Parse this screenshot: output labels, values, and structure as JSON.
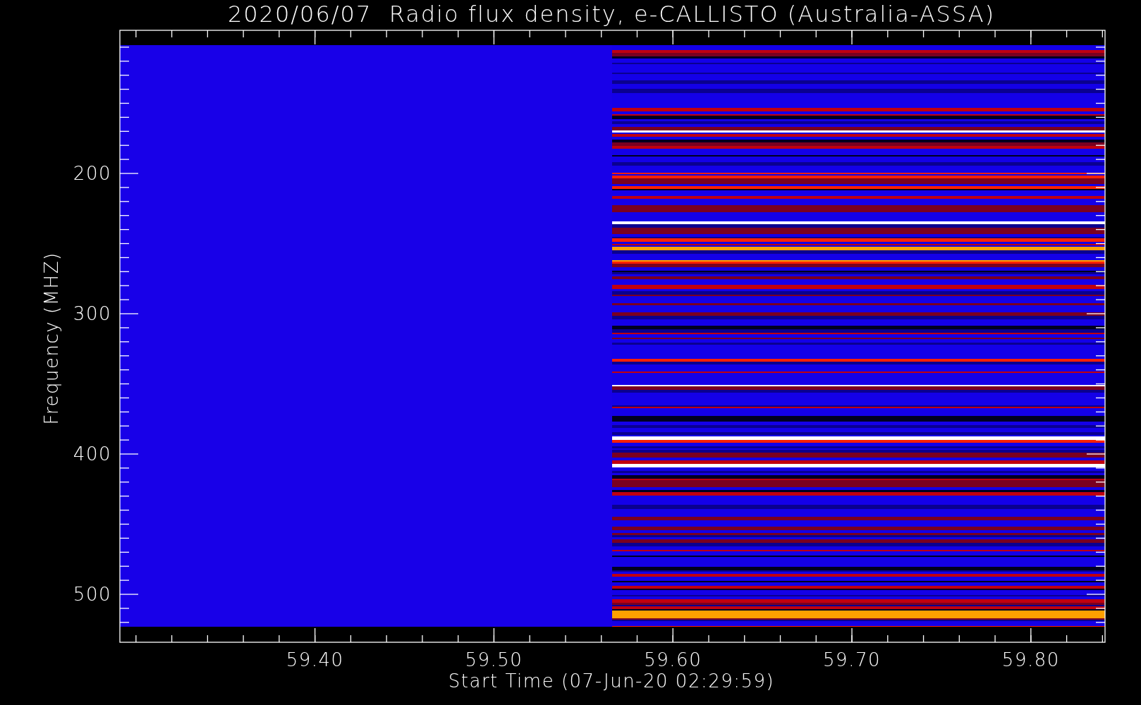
{
  "plot": {
    "title": "2020/06/07  Radio flux density, e-CALLISTO (Australia-ASSA)",
    "xlabel": "Start Time (07-Jun-20 02:29:59)",
    "ylabel": "Frequency (MHZ)",
    "xtick_labels": [
      "59.40",
      "59.50",
      "59.60",
      "59.70",
      "59.80"
    ],
    "ytick_labels": [
      "200",
      "300",
      "400",
      "500"
    ]
  }
}
